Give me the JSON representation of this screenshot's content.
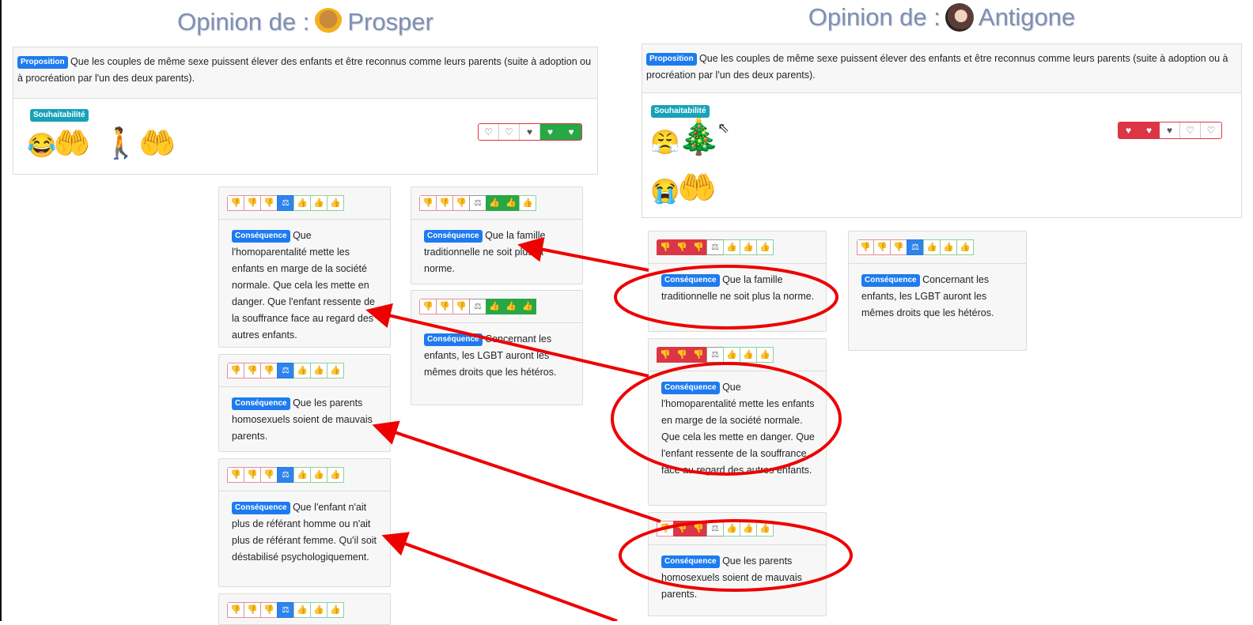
{
  "left": {
    "title_prefix": "Opinion de : ",
    "user_name": "Prosper",
    "proposition_badge": "Proposition",
    "proposition_text": "Que les couples de même sexe puissent élever des enfants et être reconnus comme leurs parents (suite à adoption ou à procréation par l'un des deux parents).",
    "souhait_badge": "Souhaitabilité",
    "hearts": [
      "♡",
      "♡",
      "♥",
      "♥",
      "♥"
    ],
    "cards": [
      {
        "badge": "Conséquence",
        "text": "Que l'homoparentalité mette les enfants en marge de la société normale. Que cela les mette en danger. Que l'enfant ressente de la souffrance face au regard des autres enfants."
      },
      {
        "badge": "Conséquence",
        "text": "Que les parents homosexuels soient de mauvais parents."
      },
      {
        "badge": "Conséquence",
        "text": "Que l'enfant n'ait plus de référant homme ou n'ait plus de référant femme. Qu'il soit déstabilisé psychologiquement."
      },
      {
        "badge": "Conséquence",
        "text": "Que la famille traditionnelle ne soit plus la norme."
      },
      {
        "badge": "Conséquence",
        "text": "Concernant les enfants, les LGBT auront les mêmes droits que les hétéros."
      }
    ]
  },
  "right": {
    "title_prefix": "Opinion de : ",
    "user_name": "Antigone",
    "proposition_badge": "Proposition",
    "proposition_text": "Que les couples de même sexe puissent élever des enfants et être reconnus comme leurs parents (suite à adoption ou à procréation par l'un des deux parents).",
    "souhait_badge": "Souhaitabilité",
    "hearts": [
      "♥",
      "♥",
      "♥",
      "♡",
      "♡"
    ],
    "cards": [
      {
        "badge": "Conséquence",
        "text": "Que la famille traditionnelle ne soit plus la norme."
      },
      {
        "badge": "Conséquence",
        "text": "Que l'homoparentalité mette les enfants en marge de la société normale. Que cela les mette en danger. Que l'enfant ressente de la souffrance face au regard des autres enfants."
      },
      {
        "badge": "Conséquence",
        "text": "Que les parents homosexuels soient de mauvais parents."
      },
      {
        "badge": "Conséquence",
        "text": "Concernant les enfants, les LGBT auront les mêmes droits que les hétéros."
      }
    ]
  },
  "icons": {
    "vote_down": "👎",
    "vote_balance": "⚖",
    "vote_up": "👍",
    "emoji_left": [
      "😂",
      "🤲",
      "🚶",
      "🤲"
    ],
    "emoji_right": [
      "😤",
      "🎄",
      "😭",
      "🤲"
    ]
  },
  "colors": {
    "annotation": "#ee0000",
    "badge_blue": "#1e7bef",
    "badge_teal": "#17a2b8",
    "danger": "#dc3545",
    "success": "#28a745"
  }
}
